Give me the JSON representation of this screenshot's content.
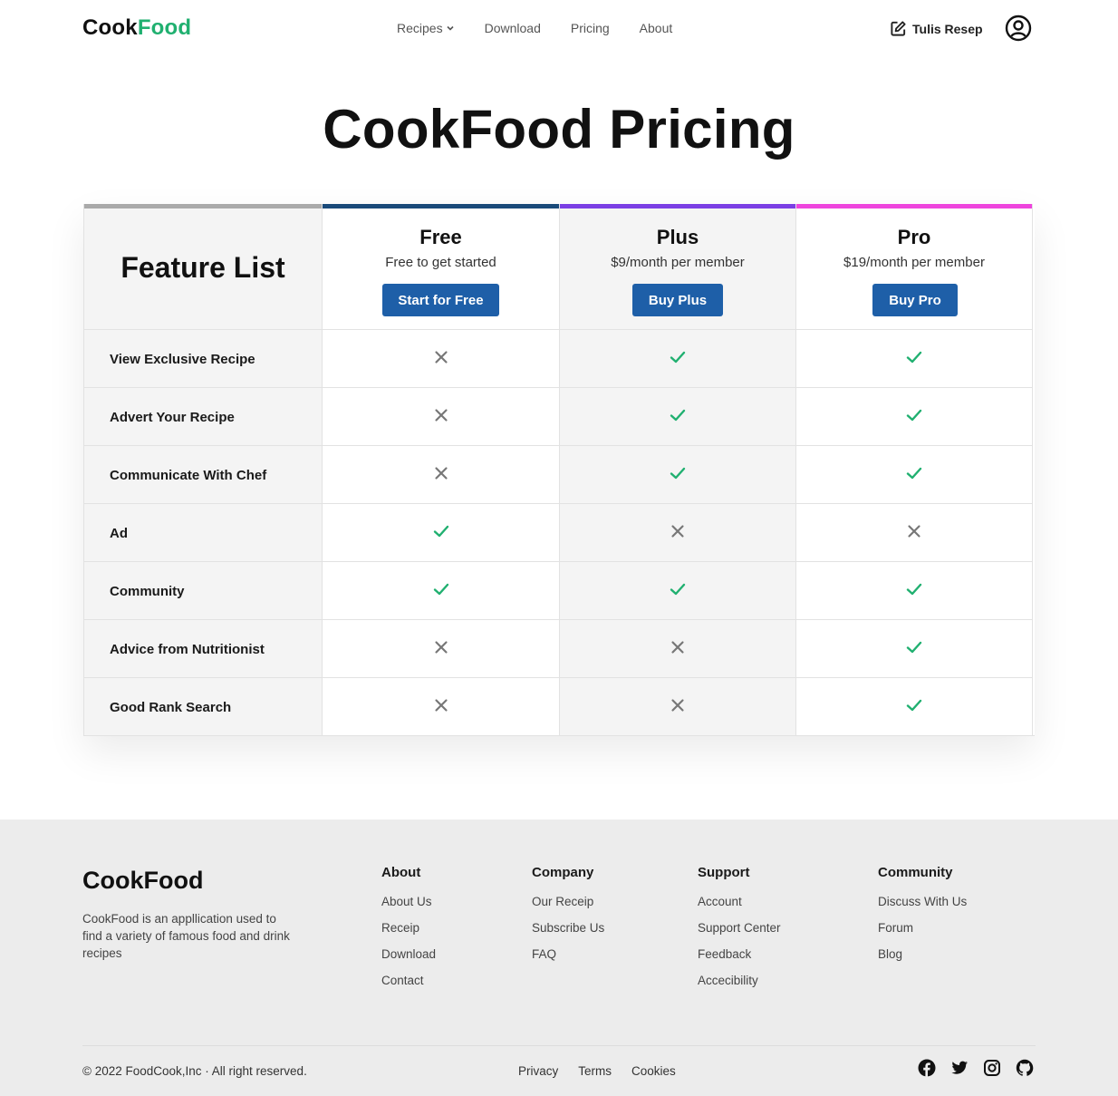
{
  "header": {
    "logo_part1": "Cook",
    "logo_part2": "Food",
    "nav": [
      "Recipes",
      "Download",
      "Pricing",
      "About"
    ],
    "write_label": "Tulis Resep"
  },
  "page_title": "CookFood Pricing",
  "pricing": {
    "feature_heading": "Feature List",
    "plans": [
      {
        "name": "Free",
        "price": "Free to get started",
        "button": "Start for Free"
      },
      {
        "name": "Plus",
        "price": "$9/month per member",
        "button": "Buy Plus"
      },
      {
        "name": "Pro",
        "price": "$19/month per member",
        "button": "Buy Pro"
      }
    ],
    "features": [
      {
        "label": "View Exclusive Recipe",
        "free": false,
        "plus": true,
        "pro": true
      },
      {
        "label": "Advert Your Recipe",
        "free": false,
        "plus": true,
        "pro": true
      },
      {
        "label": "Communicate With Chef",
        "free": false,
        "plus": true,
        "pro": true
      },
      {
        "label": "Ad",
        "free": true,
        "plus": false,
        "pro": false
      },
      {
        "label": "Community",
        "free": true,
        "plus": true,
        "pro": true
      },
      {
        "label": "Advice from Nutritionist",
        "free": false,
        "plus": false,
        "pro": true
      },
      {
        "label": "Good Rank Search",
        "free": false,
        "plus": false,
        "pro": true
      }
    ],
    "colors": {
      "check": "#20b070",
      "cross": "#777777",
      "button": "#1e5fa8"
    }
  },
  "footer": {
    "logo": "CookFood",
    "description": "CookFood is an appllication used to find a variety of famous food and drink recipes",
    "columns": [
      {
        "title": "About",
        "links": [
          "About Us",
          "Receip",
          "Download",
          "Contact"
        ]
      },
      {
        "title": "Company",
        "links": [
          "Our Receip",
          "Subscribe Us",
          "FAQ"
        ]
      },
      {
        "title": "Support",
        "links": [
          "Account",
          "Support Center",
          "Feedback",
          "Accecibility"
        ]
      },
      {
        "title": "Community",
        "links": [
          "Discuss With Us",
          "Forum",
          "Blog"
        ]
      }
    ],
    "copyright": "© 2022 FoodCook,Inc · All right reserved.",
    "legal": [
      "Privacy",
      "Terms",
      "Cookies"
    ],
    "social_icons": [
      "facebook-icon",
      "twitter-icon",
      "instagram-icon",
      "github-icon"
    ]
  }
}
